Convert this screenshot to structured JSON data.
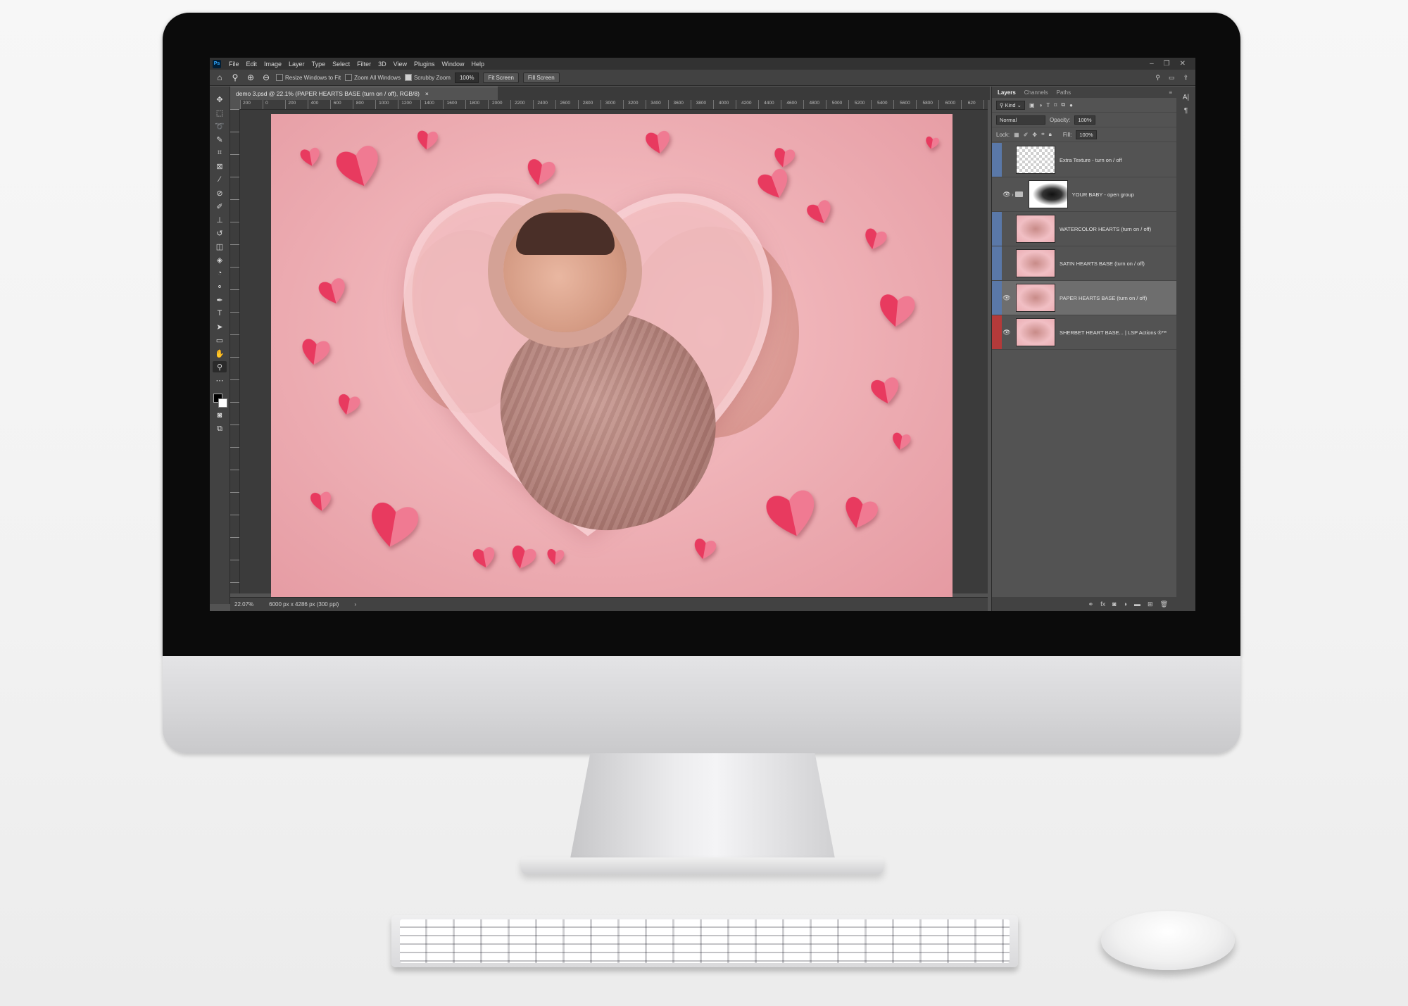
{
  "app": {
    "menu": [
      "File",
      "Edit",
      "Image",
      "Layer",
      "Type",
      "Select",
      "Filter",
      "3D",
      "View",
      "Plugins",
      "Window",
      "Help"
    ],
    "logo": "Ps"
  },
  "options_bar": {
    "resize_windows": "Resize Windows to Fit",
    "zoom_all": "Zoom All Windows",
    "scrubby_zoom": "Scrubby Zoom",
    "zoom_value": "100%",
    "fit_screen": "Fit Screen",
    "fill_screen": "Fill Screen"
  },
  "document": {
    "tab_title": "demo 3.psd @ 22.1% (PAPER HEARTS BASE (turn on / off), RGB/8)",
    "close": "×"
  },
  "ruler": {
    "h_labels": [
      "200",
      "0",
      "200",
      "400",
      "600",
      "800",
      "1000",
      "1200",
      "1400",
      "1600",
      "1800",
      "2000",
      "2200",
      "2400",
      "2600",
      "2800",
      "3000",
      "3200",
      "3400",
      "3600",
      "3800",
      "4000",
      "4200",
      "4400",
      "4600",
      "4800",
      "5000",
      "5200",
      "5400",
      "5600",
      "5800",
      "6000",
      "620"
    ]
  },
  "status": {
    "zoom": "22.07%",
    "dimensions": "6000 px x 4286 px (300 ppi)",
    "arrow": "›"
  },
  "layers_panel": {
    "tabs": [
      "Layers",
      "Channels",
      "Paths"
    ],
    "filter_kind": "Kind",
    "blend_mode": "Normal",
    "opacity_label": "Opacity:",
    "opacity_value": "100%",
    "lock_label": "Lock:",
    "fill_label": "Fill:",
    "fill_value": "100%",
    "layers": [
      {
        "name": "Extra Texture - turn on / off",
        "visible": false,
        "tag_color": "#5a78a8",
        "thumb": "check"
      },
      {
        "name": "YOUR BABY - open group",
        "visible": true,
        "tag_color": "#535353",
        "thumb": "mask",
        "group": true
      },
      {
        "name": "WATERCOLOR HEARTS (turn on / off)",
        "visible": false,
        "tag_color": "#5a78a8",
        "thumb": "pink"
      },
      {
        "name": "SATIN HEARTS BASE (turn on / off)",
        "visible": false,
        "tag_color": "#5a78a8",
        "thumb": "pink"
      },
      {
        "name": "PAPER HEARTS BASE (turn on / off)",
        "visible": true,
        "tag_color": "#5a78a8",
        "thumb": "pink",
        "selected": true
      },
      {
        "name": "SHERBET HEART BASE... | LSP Actions ®™",
        "visible": true,
        "tag_color": "#b43a3a",
        "thumb": "pink"
      }
    ]
  },
  "colors": {
    "paper_heart": "#e83a5f",
    "paper_heart_light": "#f07a92"
  }
}
